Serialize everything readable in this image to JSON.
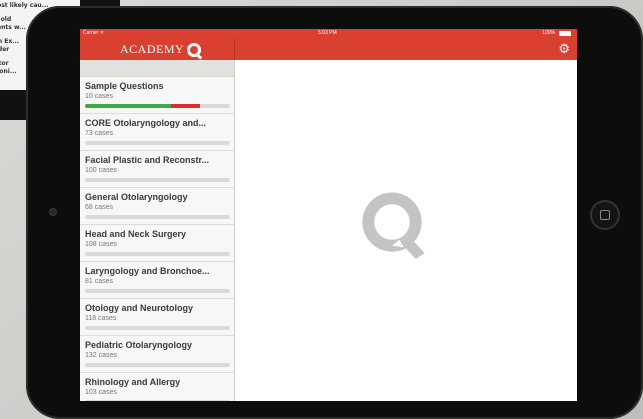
{
  "background_device": {
    "lines": [
      "...most likely cau...",
      "9 yr. old",
      "...ments w...",
      "...irin Ex...",
      "...order",
      "...uctor",
      "...phoni..."
    ]
  },
  "status_bar": {
    "carrier": "Carrier ᯤ",
    "time": "5:03 PM",
    "battery": "100%"
  },
  "header": {
    "logo_text": "ACADEMY",
    "settings_icon": "gear-icon"
  },
  "sidebar": {
    "items": [
      {
        "title": "Sample Questions",
        "count": "10 cases",
        "correct": 0.59,
        "wrong": 0.2
      },
      {
        "title": "CORE Otolaryngology and...",
        "count": "73 cases",
        "correct": 0,
        "wrong": 0
      },
      {
        "title": "Facial Plastic and Reconstr...",
        "count": "100 cases",
        "correct": 0,
        "wrong": 0
      },
      {
        "title": "General Otolaryngology",
        "count": "68 cases",
        "correct": 0,
        "wrong": 0
      },
      {
        "title": "Head and Neck Surgery",
        "count": "108 cases",
        "correct": 0,
        "wrong": 0
      },
      {
        "title": "Laryngology and Bronchoe...",
        "count": "81 cases",
        "correct": 0,
        "wrong": 0
      },
      {
        "title": "Otology and Neurotology",
        "count": "118 cases",
        "correct": 0,
        "wrong": 0
      },
      {
        "title": "Pediatric Otolaryngology",
        "count": "132 cases",
        "correct": 0,
        "wrong": 0
      },
      {
        "title": "Rhinology and Allergy",
        "count": "103 cases",
        "correct": 0,
        "wrong": 0
      }
    ]
  },
  "colors": {
    "brand_red": "#d9402f",
    "progress_correct": "#3eab47",
    "progress_wrong": "#d9302f",
    "watermark": "#c4c4c6"
  }
}
